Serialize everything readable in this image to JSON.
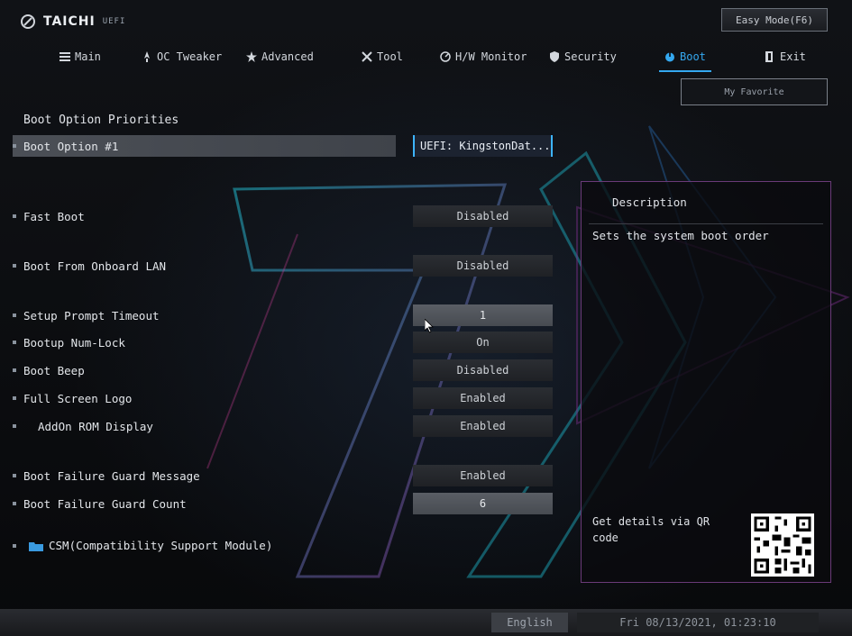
{
  "brand": {
    "name": "TAICHI",
    "sub": "UEFI"
  },
  "easy_mode_label": "Easy Mode(F6)",
  "nav": [
    {
      "label": "Main",
      "icon": "list-icon"
    },
    {
      "label": "OC Tweaker",
      "icon": "rocket-icon"
    },
    {
      "label": "Advanced",
      "icon": "star-icon"
    },
    {
      "label": "Tool",
      "icon": "tools-icon"
    },
    {
      "label": "H/W Monitor",
      "icon": "monitor-icon"
    },
    {
      "label": "Security",
      "icon": "shield-icon"
    },
    {
      "label": "Boot",
      "icon": "power-icon"
    },
    {
      "label": "Exit",
      "icon": "exit-icon"
    }
  ],
  "active_tab": "Boot",
  "favorite_label": "My Favorite",
  "section_title": "Boot Option Priorities",
  "settings": [
    {
      "label": "Boot Option #1",
      "value": "UEFI: KingstonDat..."
    },
    {
      "label": "Fast Boot",
      "value": "Disabled"
    },
    {
      "label": "Boot From Onboard LAN",
      "value": "Disabled"
    },
    {
      "label": "Setup Prompt Timeout",
      "value": "1"
    },
    {
      "label": "Bootup Num-Lock",
      "value": "On"
    },
    {
      "label": "Boot Beep",
      "value": "Disabled"
    },
    {
      "label": "Full Screen Logo",
      "value": "Enabled"
    },
    {
      "label": "AddOn ROM Display",
      "value": "Enabled"
    },
    {
      "label": "Boot Failure Guard Message",
      "value": "Enabled"
    },
    {
      "label": "Boot Failure Guard Count",
      "value": "6"
    }
  ],
  "csm_label": "CSM(Compatibility Support Module)",
  "description": {
    "title": "Description",
    "text": "Sets the system boot order",
    "qr_text": "Get details via QR code"
  },
  "footer": {
    "language": "English",
    "datetime": "Fri 08/13/2021, 01:23:10"
  },
  "colors": {
    "accent": "#34a8f0",
    "description_border": "#6a3a78"
  }
}
